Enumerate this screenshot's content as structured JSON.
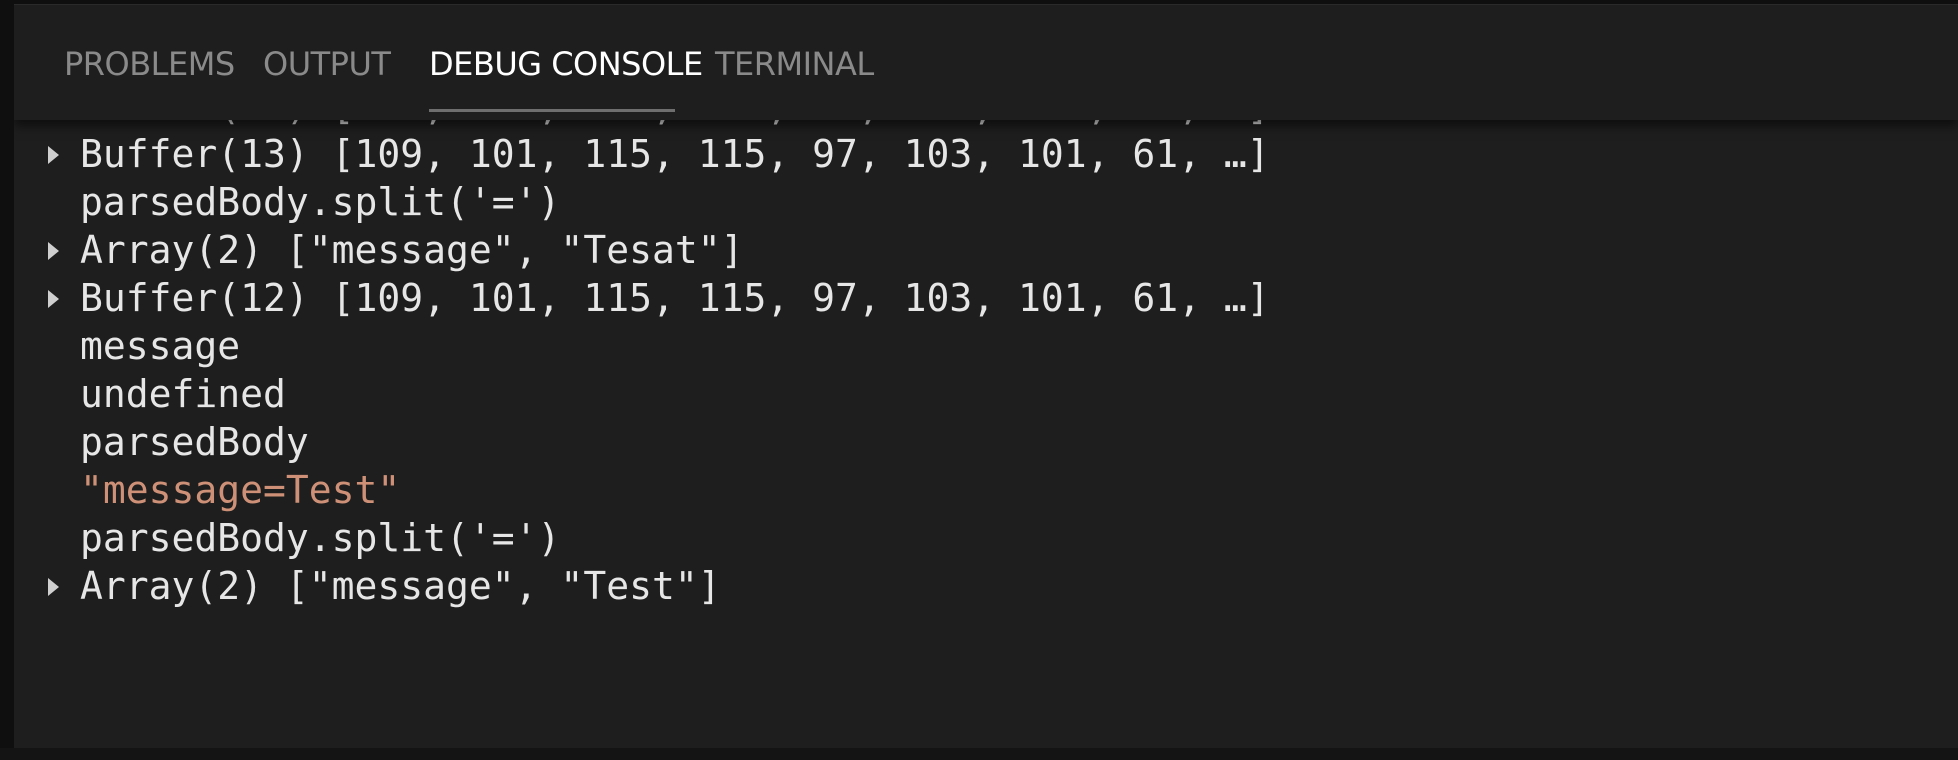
{
  "tabs": [
    {
      "label": "PROBLEMS",
      "active": false
    },
    {
      "label": "OUTPUT",
      "active": false
    },
    {
      "label": "DEBUG CONSOLE",
      "active": true
    },
    {
      "label": "TERMINAL",
      "active": false
    }
  ],
  "console": {
    "lines": [
      {
        "text": "Buffer(12) [109, 101, 115, 115, 97, 103, 101, 61, …]",
        "expandable": true,
        "kind": "object"
      },
      {
        "text": "Buffer(13) [109, 101, 115, 115, 97, 103, 101, 61, …]",
        "expandable": true,
        "kind": "object"
      },
      {
        "text": "parsedBody.split('=')",
        "expandable": false,
        "kind": "input"
      },
      {
        "text": "Array(2) [\"message\", \"Tesat\"]",
        "expandable": true,
        "kind": "object"
      },
      {
        "text": "Buffer(12) [109, 101, 115, 115, 97, 103, 101, 61, …]",
        "expandable": true,
        "kind": "object"
      },
      {
        "text": "message",
        "expandable": false,
        "kind": "input"
      },
      {
        "text": "undefined",
        "expandable": false,
        "kind": "output"
      },
      {
        "text": "parsedBody",
        "expandable": false,
        "kind": "input"
      },
      {
        "text": "\"message=Test\"",
        "expandable": false,
        "kind": "string"
      },
      {
        "text": "parsedBody.split('=')",
        "expandable": false,
        "kind": "input"
      },
      {
        "text": "Array(2) [\"message\", \"Test\"]",
        "expandable": true,
        "kind": "object"
      }
    ]
  },
  "colors": {
    "panel_background": "#1e1e1e",
    "tab_inactive": "#8a8a8a",
    "tab_active": "#ffffff",
    "console_text": "#e6e6e6",
    "string_value": "#ce9178"
  }
}
